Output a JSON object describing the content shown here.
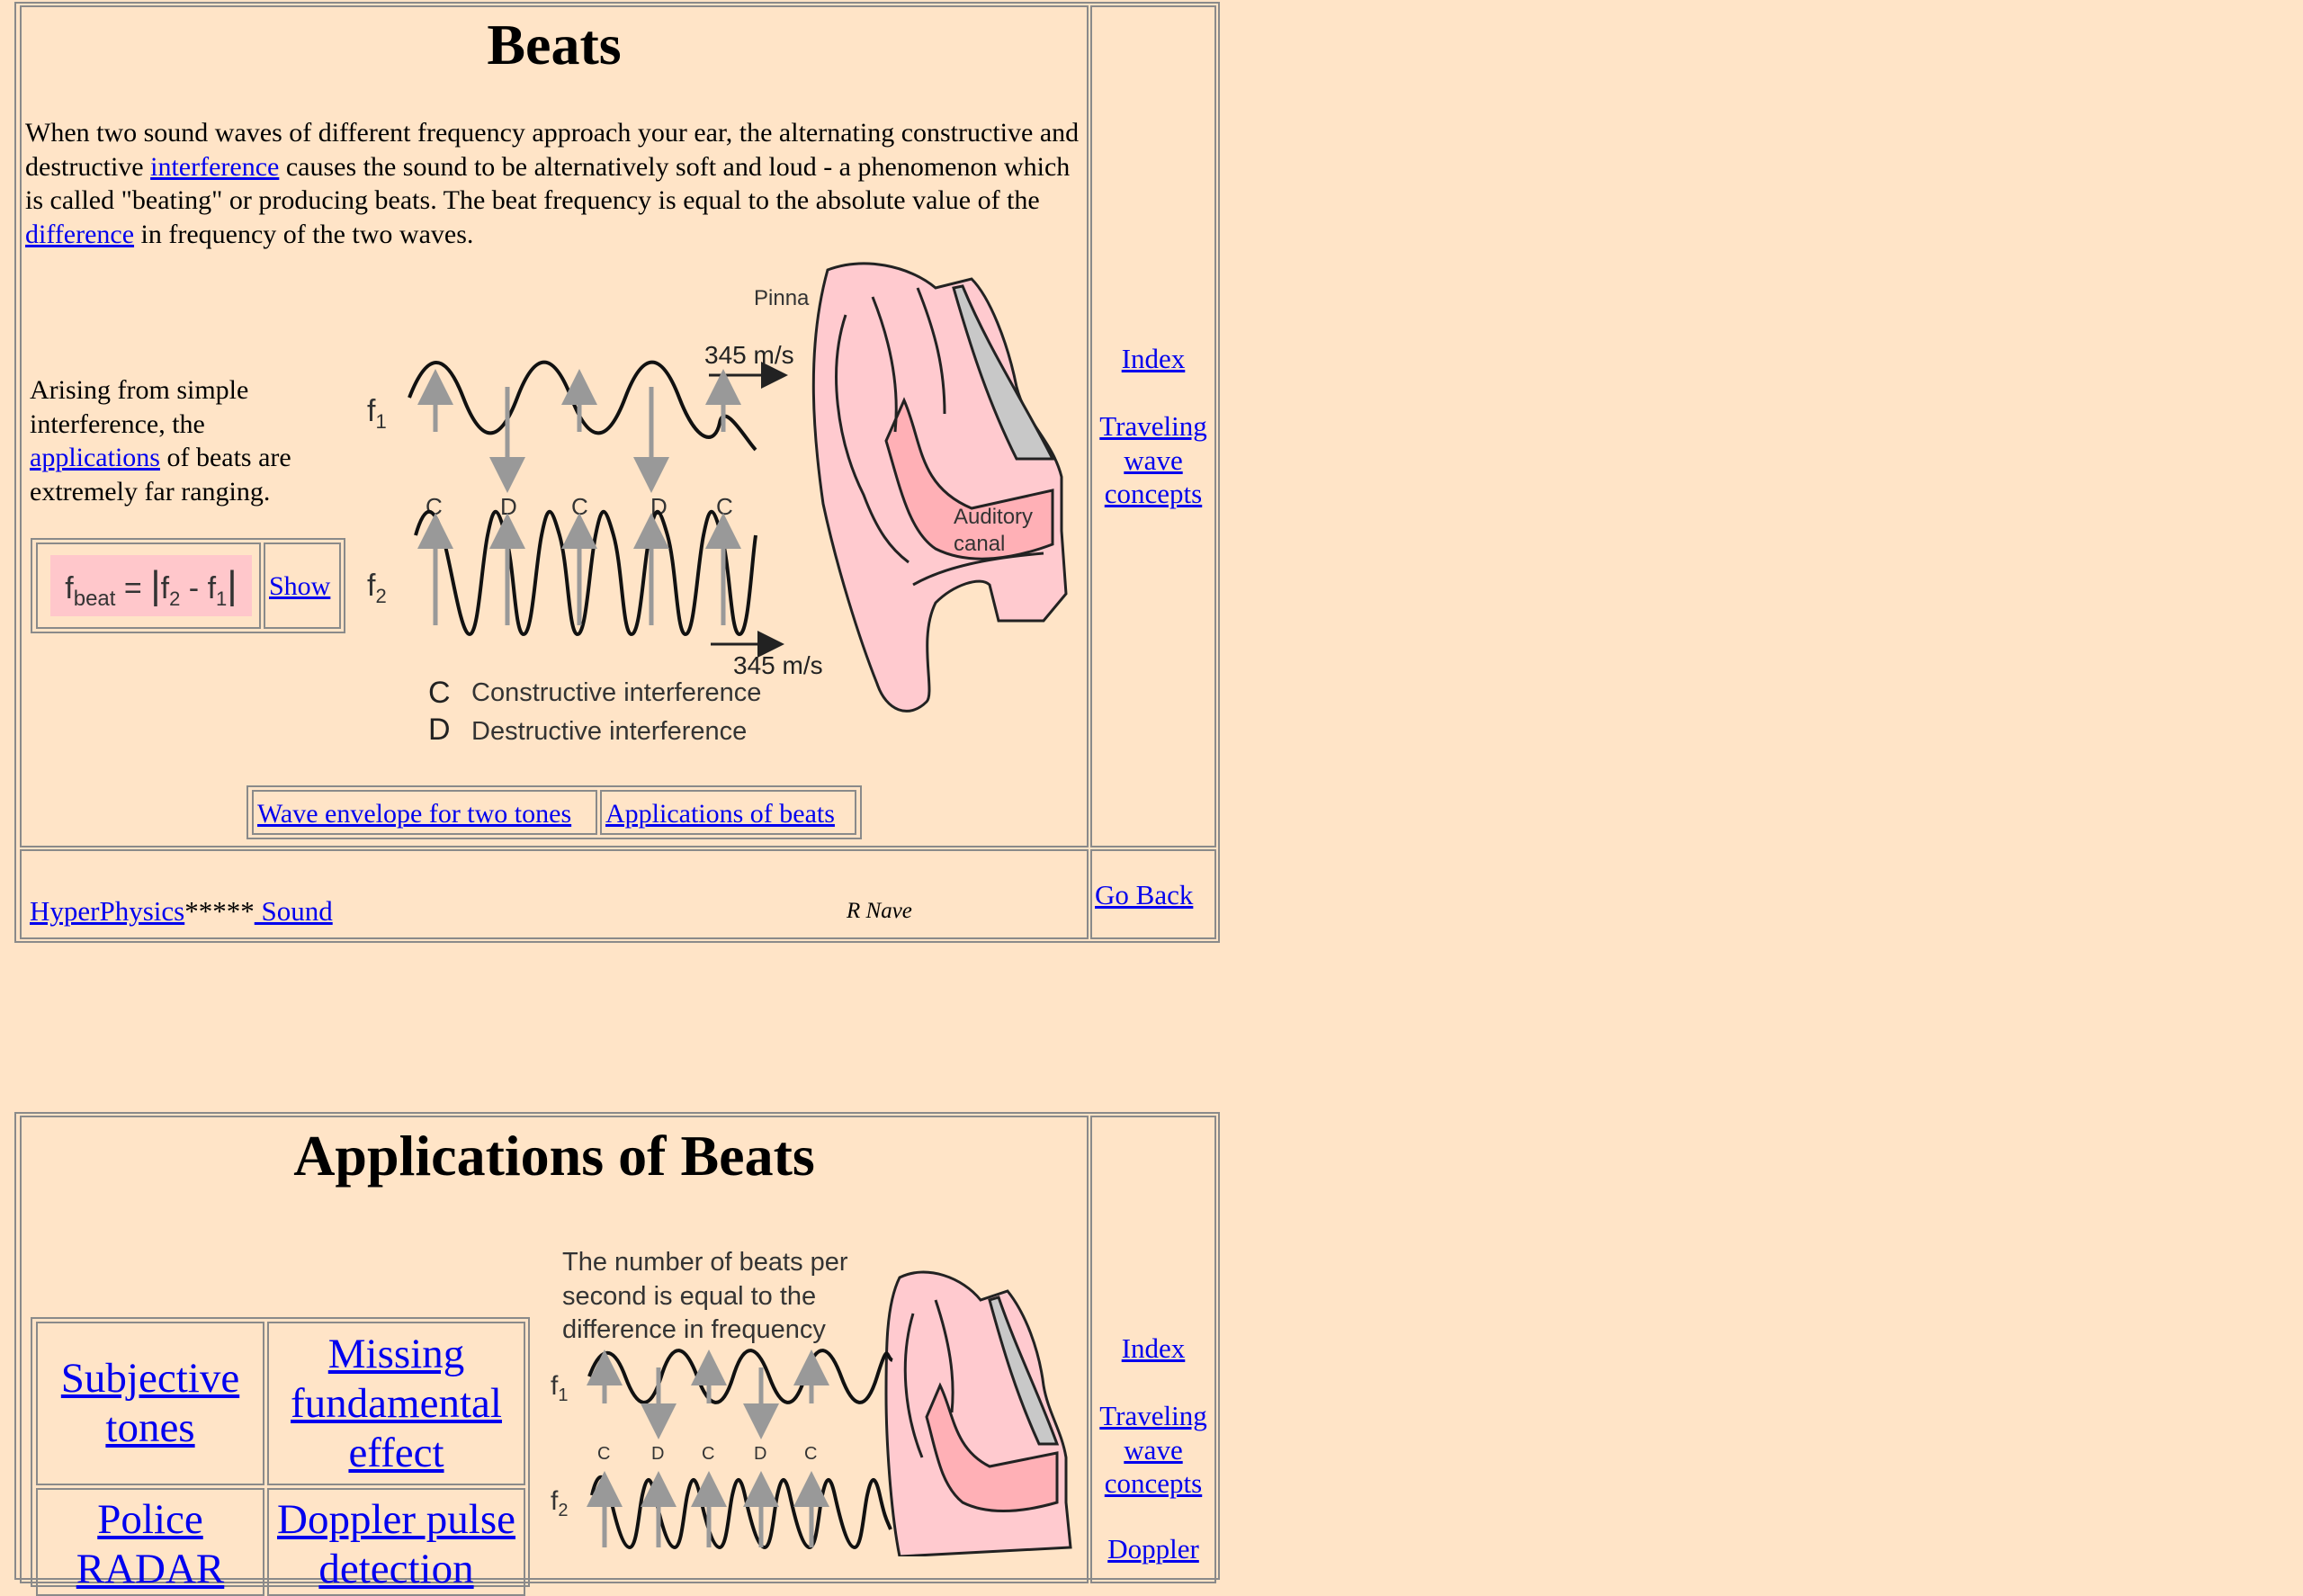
{
  "beats": {
    "title": "Beats",
    "intro": {
      "t1": "When two sound waves of different frequency approach your ear, the alternating constructive and destructive ",
      "link1": "interference",
      "t2": " causes the sound to be alternatively soft and loud - a phenomenon which is called \"beating\" or producing beats. The beat frequency is equal to the absolute value of the ",
      "link2": "difference",
      "t3": " in frequency of the two waves."
    },
    "side": {
      "t1": "Arising from simple interference, the ",
      "link": "applications",
      "t2": " of beats are extremely far ranging."
    },
    "formula": {
      "f": "f",
      "beat": "beat",
      "eq": " = ",
      "f2": "f",
      "sub2": "2",
      "minus": " - ",
      "f1": "f",
      "sub1": "1"
    },
    "show_label": "Show",
    "diagram": {
      "pinna": "Pinna",
      "speed_top": "345 m/s",
      "speed_bottom": "345 m/s",
      "f1": "f",
      "f1_sub": "1",
      "f2": "f",
      "f2_sub": "2",
      "cd_labels": [
        "C",
        "D",
        "C",
        "D",
        "C"
      ],
      "canal_line1": "Auditory",
      "canal_line2": "canal",
      "legend_c_letter": "C",
      "legend_c": "Constructive interference",
      "legend_d_letter": "D",
      "legend_d": "Destructive interference"
    },
    "buttons": {
      "envelope": "Wave envelope for two tones",
      "applications": "Applications of beats"
    },
    "nav": {
      "index": "Index",
      "traveling": "Traveling wave concepts"
    },
    "footer": {
      "hyperphysics": "HyperPhysics",
      "stars": "*****",
      "sound": " Sound",
      "author": "R Nave",
      "go_back": "Go Back"
    }
  },
  "applications": {
    "title": "Applications of Beats",
    "links": {
      "subjective": "Subjective tones",
      "missing": "Missing fundamental effect",
      "police": "Police RADAR",
      "doppler_pulse": "Doppler pulse detection"
    },
    "caption": "The number of beats per second is equal to the difference in frequency",
    "diagram": {
      "f1": "f",
      "f1_sub": "1",
      "f2": "f",
      "f2_sub": "2",
      "cd_labels": [
        "C",
        "D",
        "C",
        "D",
        "C"
      ]
    },
    "nav": {
      "index": "Index",
      "traveling": "Traveling wave concepts",
      "doppler": "Doppler"
    }
  }
}
